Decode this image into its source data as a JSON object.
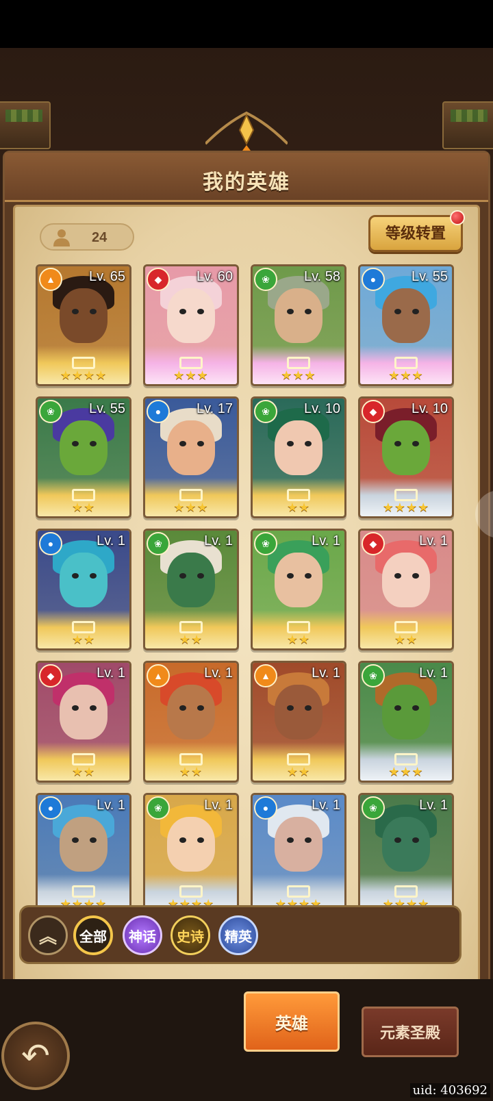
{
  "title": "我的英雄",
  "hero_count": "24",
  "reset_button": "等级转置",
  "heroes": [
    {
      "level": "Lv. 65",
      "element": "fire",
      "stars": "★★★★",
      "base": "gold",
      "bg": "#b5782f",
      "hair": "#2a1a12",
      "skin": "#7a4a2a"
    },
    {
      "level": "Lv. 60",
      "element": "red",
      "stars": "★★★",
      "base": "pink",
      "bg": "#e79aa8",
      "hair": "#f4d2d8",
      "skin": "#f6d9cc"
    },
    {
      "level": "Lv. 58",
      "element": "wind",
      "stars": "★★★",
      "base": "pink",
      "bg": "#6e9a4a",
      "hair": "#9aa88a",
      "skin": "#d9b08a"
    },
    {
      "level": "Lv. 55",
      "element": "water",
      "stars": "★★★",
      "base": "pink",
      "bg": "#6ea9d8",
      "hair": "#3fa8e0",
      "skin": "#9a6a4a"
    },
    {
      "level": "Lv. 55",
      "element": "wind",
      "stars": "★★",
      "base": "gold",
      "bg": "#3a7a4a",
      "hair": "#4a3aa0",
      "skin": "#6aa83a"
    },
    {
      "level": "Lv. 17",
      "element": "water",
      "stars": "★★★",
      "base": "gold",
      "bg": "#3a5a9a",
      "hair": "#e8dcc8",
      "skin": "#e8b08a"
    },
    {
      "level": "Lv. 10",
      "element": "wind",
      "stars": "★★",
      "base": "gold",
      "bg": "#2a6a5a",
      "hair": "#1e6a4a",
      "skin": "#f0c8b0"
    },
    {
      "level": "Lv. 10",
      "element": "red",
      "stars": "★★★★",
      "base": "silver",
      "bg": "#b84a3a",
      "hair": "#7a1e2a",
      "skin": "#6aa83a"
    },
    {
      "level": "Lv. 1",
      "element": "water",
      "stars": "★★",
      "base": "gold",
      "bg": "#3a4a8a",
      "hair": "#2ea8c8",
      "skin": "#4ac0c8"
    },
    {
      "level": "Lv. 1",
      "element": "wind",
      "stars": "★★",
      "base": "gold",
      "bg": "#5a8a3a",
      "hair": "#e8e0d0",
      "skin": "#3a7a4a"
    },
    {
      "level": "Lv. 1",
      "element": "wind",
      "stars": "★★",
      "base": "gold",
      "bg": "#6aa84a",
      "hair": "#3aa05a",
      "skin": "#e8c0a0"
    },
    {
      "level": "Lv. 1",
      "element": "red",
      "stars": "★★",
      "base": "gold",
      "bg": "#d88a8a",
      "hair": "#e86a6a",
      "skin": "#f4d0c0"
    },
    {
      "level": "Lv. 1",
      "element": "red",
      "stars": "★★",
      "base": "gold",
      "bg": "#a04a6a",
      "hair": "#c0306a",
      "skin": "#e8c0b0"
    },
    {
      "level": "Lv. 1",
      "element": "fire",
      "stars": "★★",
      "base": "gold",
      "bg": "#c86a2a",
      "hair": "#d84a2a",
      "skin": "#b8784a"
    },
    {
      "level": "Lv. 1",
      "element": "fire",
      "stars": "★★",
      "base": "gold",
      "bg": "#a04a2a",
      "hair": "#c87a3a",
      "skin": "#9a5a3a"
    },
    {
      "level": "Lv. 1",
      "element": "wind",
      "stars": "★★★",
      "base": "silver",
      "bg": "#4a8a4a",
      "hair": "#b06a2a",
      "skin": "#5a9a3a"
    },
    {
      "level": "Lv. 1",
      "element": "water",
      "stars": "★★★★",
      "base": "silver",
      "bg": "#4a7ab8",
      "hair": "#4aa8d8",
      "skin": "#c0a080"
    },
    {
      "level": "Lv. 1",
      "element": "wind",
      "stars": "★★★★",
      "base": "silver",
      "bg": "#d8a84a",
      "hair": "#f2b83a",
      "skin": "#f4d0b0"
    },
    {
      "level": "Lv. 1",
      "element": "water",
      "stars": "★★★★",
      "base": "silver",
      "bg": "#5a8ac8",
      "hair": "#e0e8f0",
      "skin": "#d8b0a0"
    },
    {
      "level": "Lv. 1",
      "element": "wind",
      "stars": "★★★★",
      "base": "silver",
      "bg": "#4a7a4a",
      "hair": "#2a6a4a",
      "skin": "#3a7a5a"
    }
  ],
  "filters": {
    "all": "全部",
    "mythic": "神话",
    "epic": "史诗",
    "elite": "精英"
  },
  "nav": {
    "hero_tab": "英雄",
    "element_tab": "元素圣殿"
  },
  "uid": "uid: 403692",
  "colors": {
    "fire": "#f08a1a",
    "red": "#d8262a",
    "wind": "#3aa63a",
    "water": "#1e7ad8"
  },
  "icons": {
    "element_fire": "flame",
    "element_wind": "leaf-swirl",
    "element_water": "droplet",
    "element_red": "gem"
  }
}
